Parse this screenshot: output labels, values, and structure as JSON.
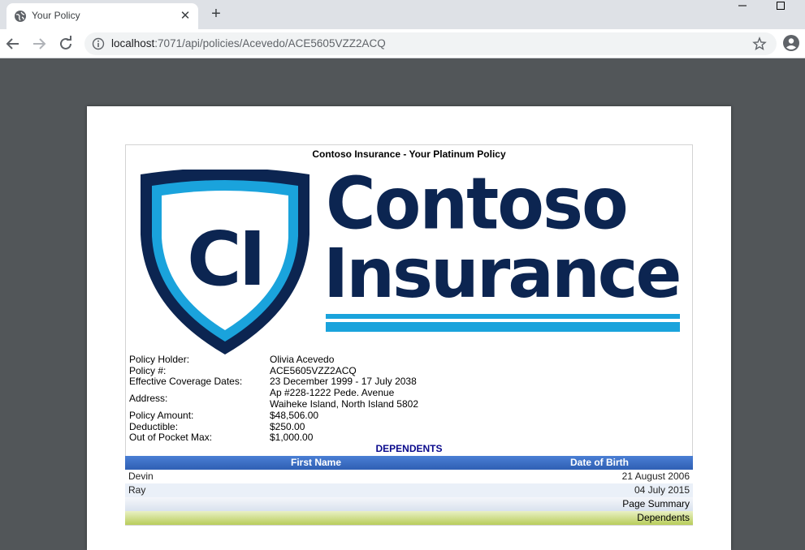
{
  "browser": {
    "tab_title": "Your Policy",
    "tab_close": "✕",
    "new_tab": "+",
    "url_host": "localhost",
    "url_path": ":7071/api/policies/Acevedo/ACE5605VZZ2ACQ"
  },
  "report": {
    "title": "Contoso Insurance - Your Platinum Policy",
    "logo": {
      "initials": "CI",
      "word1": "Contoso",
      "word2": "Insurance"
    },
    "fields": [
      {
        "label": "Policy Holder:",
        "value": "Olivia Acevedo"
      },
      {
        "label": "Policy #:",
        "value": "ACE5605VZZ2ACQ"
      },
      {
        "label": "Effective Coverage Dates:",
        "value": "23 December 1999 - 17 July 2038"
      },
      {
        "label": "Address:",
        "value_line1": "Ap #228-1222 Pede. Avenue",
        "value_line2": "Waiheke Island, North Island 5802"
      },
      {
        "label": "Policy Amount:",
        "value": "$48,506.00"
      },
      {
        "label": "Deductible:",
        "value": "$250.00"
      },
      {
        "label": "Out of Pocket Max:",
        "value": "$1,000.00"
      }
    ],
    "dependents": {
      "title": "DEPENDENTS",
      "columns": [
        "First Name",
        "Date of Birth"
      ],
      "rows": [
        {
          "first_name": "Devin",
          "dob": "21 August 2006"
        },
        {
          "first_name": "Ray",
          "dob": "04 July 2015"
        }
      ],
      "summary_label": "Page Summary",
      "footer_label": "Dependents"
    }
  },
  "colors": {
    "brand_navy": "#0c2551",
    "brand_cyan": "#1aa3dc",
    "table_header": "#3b6fc6",
    "dependents_title": "#0a0a8c"
  },
  "icons": [
    "globe-icon",
    "close-icon",
    "plus-icon",
    "minimize-icon",
    "maximize-icon",
    "back-icon",
    "forward-icon",
    "reload-icon",
    "info-icon",
    "star-icon",
    "profile-icon"
  ]
}
